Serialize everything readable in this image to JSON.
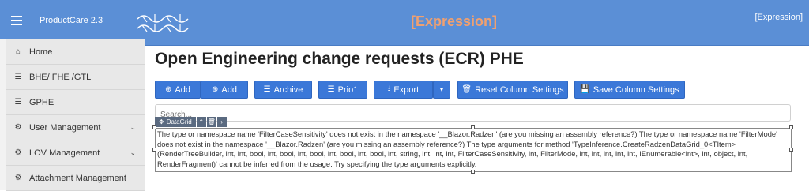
{
  "header": {
    "app_name": "ProductCare 2.3",
    "center_label": "[Expression]",
    "right_label": "[Expression]"
  },
  "sidebar": {
    "items": [
      {
        "label": "Home",
        "icon": "home-icon"
      },
      {
        "label": "BHE/ FHE /GTL",
        "icon": "list-icon"
      },
      {
        "label": "GPHE",
        "icon": "list-icon"
      },
      {
        "label": "User Management",
        "icon": "gear-icon"
      },
      {
        "label": "LOV Management",
        "icon": "gear-icon"
      },
      {
        "label": "Attachment Management",
        "icon": "gear-icon"
      }
    ]
  },
  "page": {
    "title": "Open Engineering change requests (ECR) PHE"
  },
  "toolbar": {
    "add1": "Add",
    "add2": "Add",
    "archive": "Archive",
    "prio1": "Prio1",
    "export": "Export",
    "reset": "Reset Column Settings",
    "save": "Save Column Settings"
  },
  "search": {
    "placeholder": "Search..."
  },
  "designer": {
    "component_label": "DataGrid"
  },
  "error": {
    "message": "The type or namespace name 'FilterCaseSensitivity' does not exist in the namespace '__Blazor.Radzen' (are you missing an assembly reference?) The type or namespace name 'FilterMode' does not exist in the namespace '__Blazor.Radzen' (are you missing an assembly reference?) The type arguments for method 'TypeInference.CreateRadzenDataGrid_0<TItem>(RenderTreeBuilder, int, int, bool, int, bool, int, bool, int, bool, int, bool, int, string, int, int, int, FilterCaseSensitivity, int, FilterMode, int, int, int, int, int, IEnumerable<int>, int, object, int, RenderFragment)' cannot be inferred from the usage. Try specifying the type arguments explicitly."
  },
  "colors": {
    "topbar": "#5b8fd6",
    "button": "#3b78d8",
    "expression": "#f0a070"
  }
}
